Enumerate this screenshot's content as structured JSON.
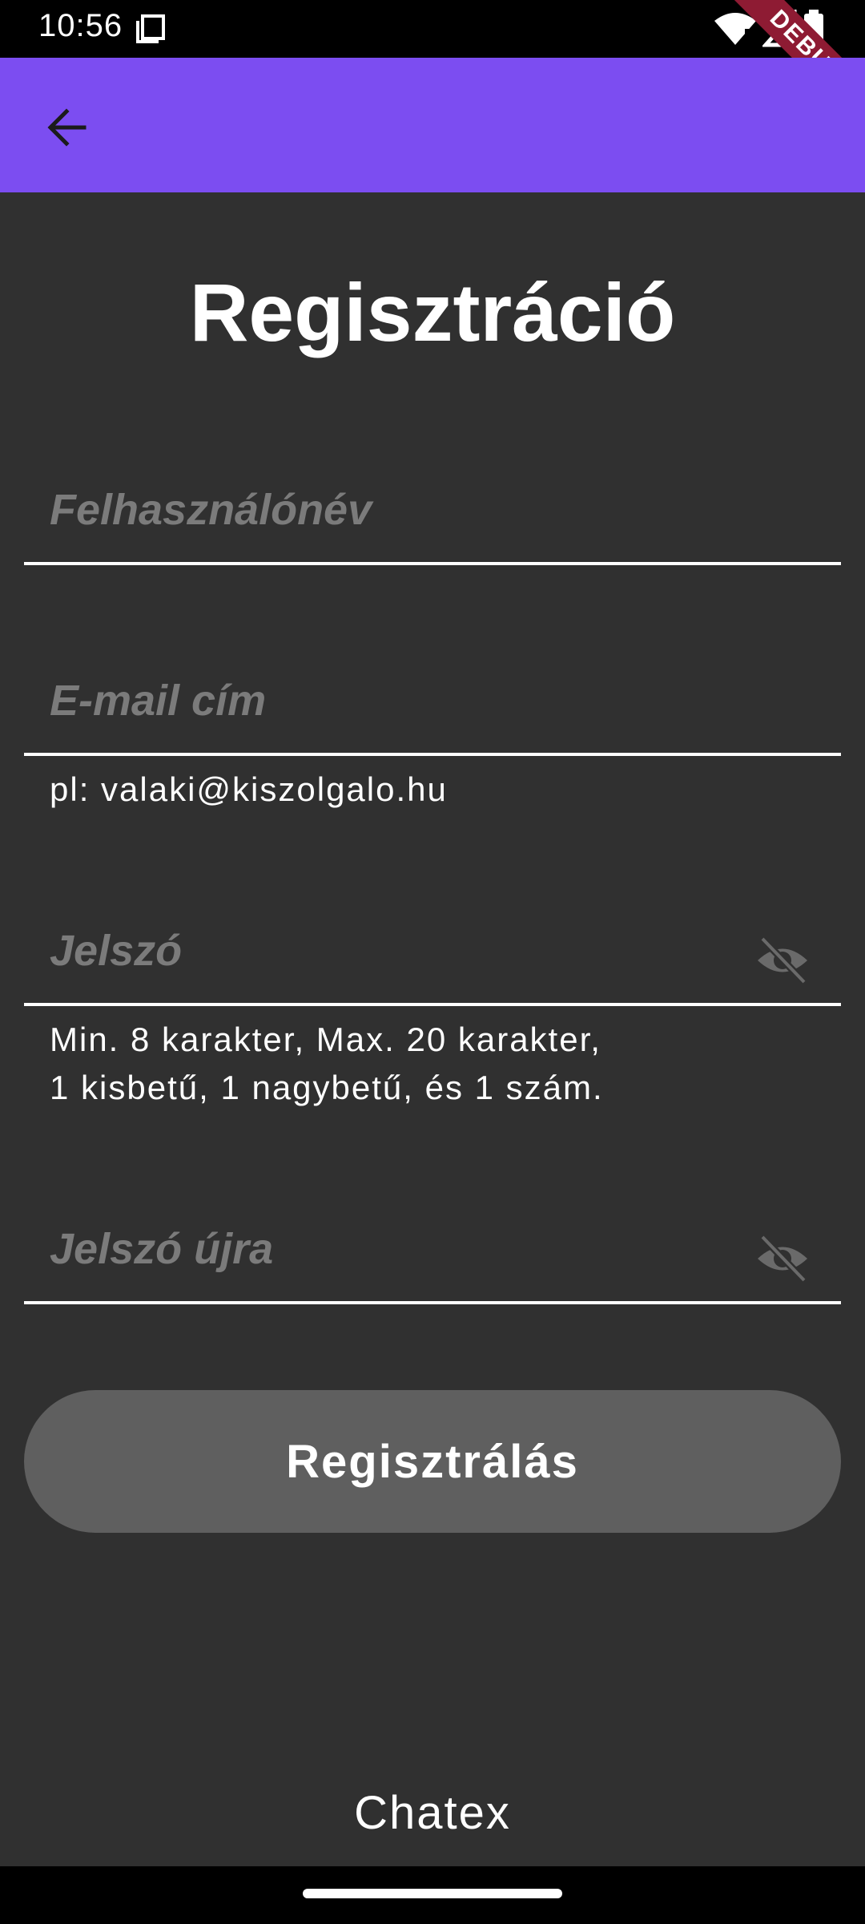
{
  "status_bar": {
    "time": "10:56",
    "icons": [
      "screen-icon",
      "wifi-icon",
      "signal-icon",
      "battery-icon"
    ]
  },
  "debug_banner": "DEBUG",
  "app_bar": {
    "color": "#7c4df1",
    "back_icon": "arrow-back-icon"
  },
  "title": "Regisztráció",
  "form": {
    "username": {
      "placeholder": "Felhasználónév",
      "value": ""
    },
    "email": {
      "placeholder": "E-mail cím",
      "value": "",
      "helper": "pl: valaki@kiszolgalo.hu"
    },
    "password": {
      "placeholder": "Jelszó",
      "value": "",
      "helper_line1": "Min. 8 karakter, Max. 20 karakter,",
      "helper_line2": "1 kisbetű, 1 nagybetű, és 1 szám.",
      "toggle_icon": "visibility-off-icon"
    },
    "password_confirm": {
      "placeholder": "Jelszó újra",
      "value": "",
      "toggle_icon": "visibility-off-icon"
    }
  },
  "submit_label": "Regisztrálás",
  "footer": "Chatex",
  "colors": {
    "background": "#303030",
    "accent": "#7c4df1",
    "button": "#5f5f5f",
    "placeholder": "#7b7b7b"
  }
}
